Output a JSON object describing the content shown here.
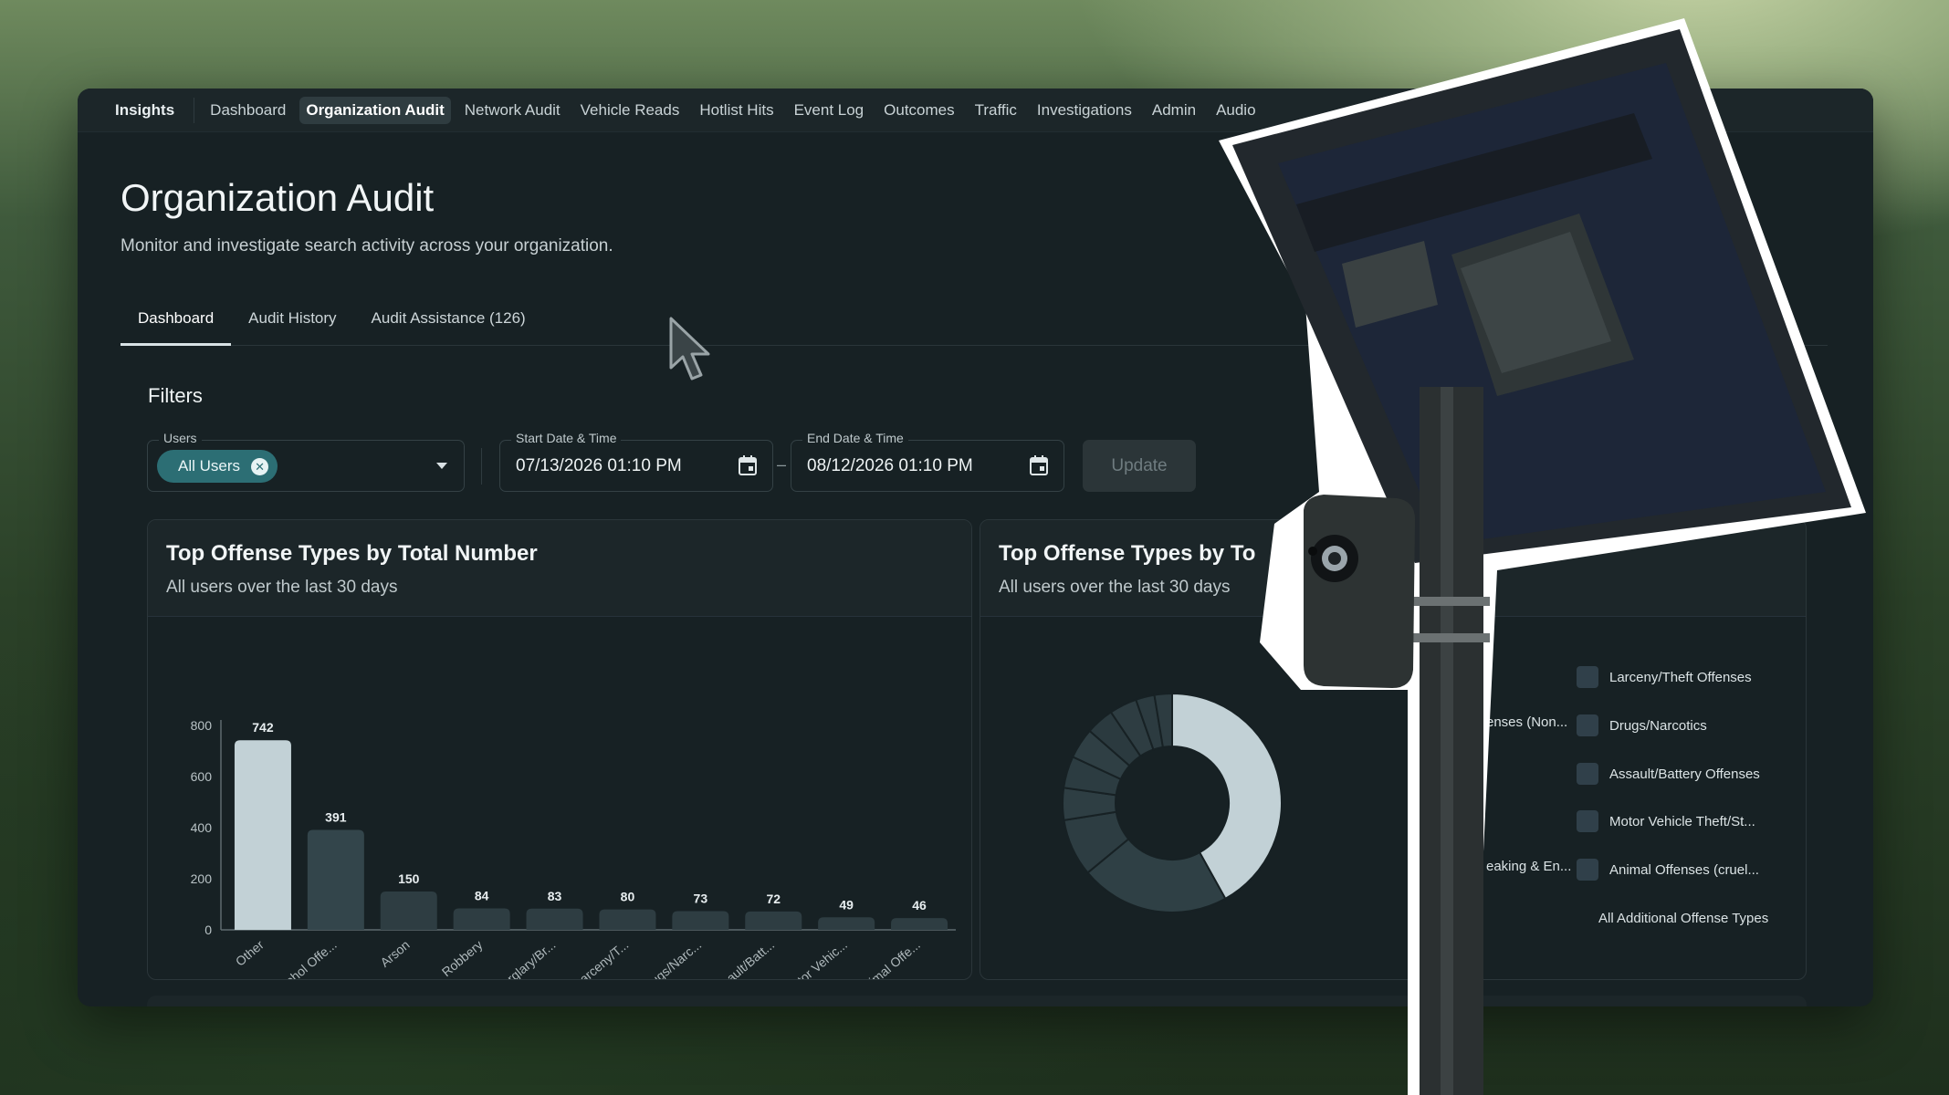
{
  "nav": {
    "brand": "Insights",
    "items": [
      "Dashboard",
      "Organization Audit",
      "Network Audit",
      "Vehicle Reads",
      "Hotlist Hits",
      "Event Log",
      "Outcomes",
      "Traffic",
      "Investigations",
      "Admin",
      "Audio"
    ],
    "active": "Organization Audit"
  },
  "page": {
    "title": "Organization Audit",
    "subtitle": "Monitor and investigate search activity across your organization."
  },
  "tabs": [
    "Dashboard",
    "Audit History",
    "Audit Assistance (126)"
  ],
  "filters": {
    "heading": "Filters",
    "users_label": "Users",
    "users_chip": "All Users",
    "start_label": "Start Date & Time",
    "start_value": "07/13/2026 01:10 PM",
    "end_label": "End Date & Time",
    "end_value": "08/12/2026 01:10 PM",
    "update_label": "Update"
  },
  "bar_card": {
    "title": "Top Offense Types by Total Number",
    "subtitle": "All users over the last 30 days"
  },
  "donut_card": {
    "title": "Top Offense Types by To",
    "subtitle": "All users over the last 30 days",
    "legend_partial": [
      "enses (Non...",
      "eaking & En..."
    ],
    "legend": [
      "Larceny/Theft Offenses",
      "Drugs/Narcotics",
      "Assault/Battery Offenses",
      "Motor Vehicle Theft/St...",
      "Animal Offenses (cruel...",
      "All Additional Offense Types"
    ]
  },
  "colors": {
    "highlight_bar": "#c2d1d6",
    "second_bar": "#33454b",
    "other_bar": "#2e3d42",
    "chip": "#2c6e74"
  },
  "chart_data": [
    {
      "type": "bar",
      "categories": [
        "Other",
        "Alcohol Offe...",
        "Arson",
        "Robbery",
        "Burglary/Br...",
        "Larceny/T...",
        "Drugs/Narc...",
        "Assault/Batt...",
        "Motor Vehic...",
        "Animal Offe..."
      ],
      "values": [
        742,
        391,
        150,
        84,
        83,
        80,
        73,
        72,
        49,
        46
      ],
      "title": "Top Offense Types by Total Number",
      "ylim": [
        0,
        800
      ],
      "yticks": [
        0,
        200,
        400,
        600,
        800
      ]
    },
    {
      "type": "pie",
      "donut": true,
      "values": [
        742,
        391,
        150,
        84,
        83,
        80,
        73,
        72,
        49,
        46
      ]
    }
  ]
}
